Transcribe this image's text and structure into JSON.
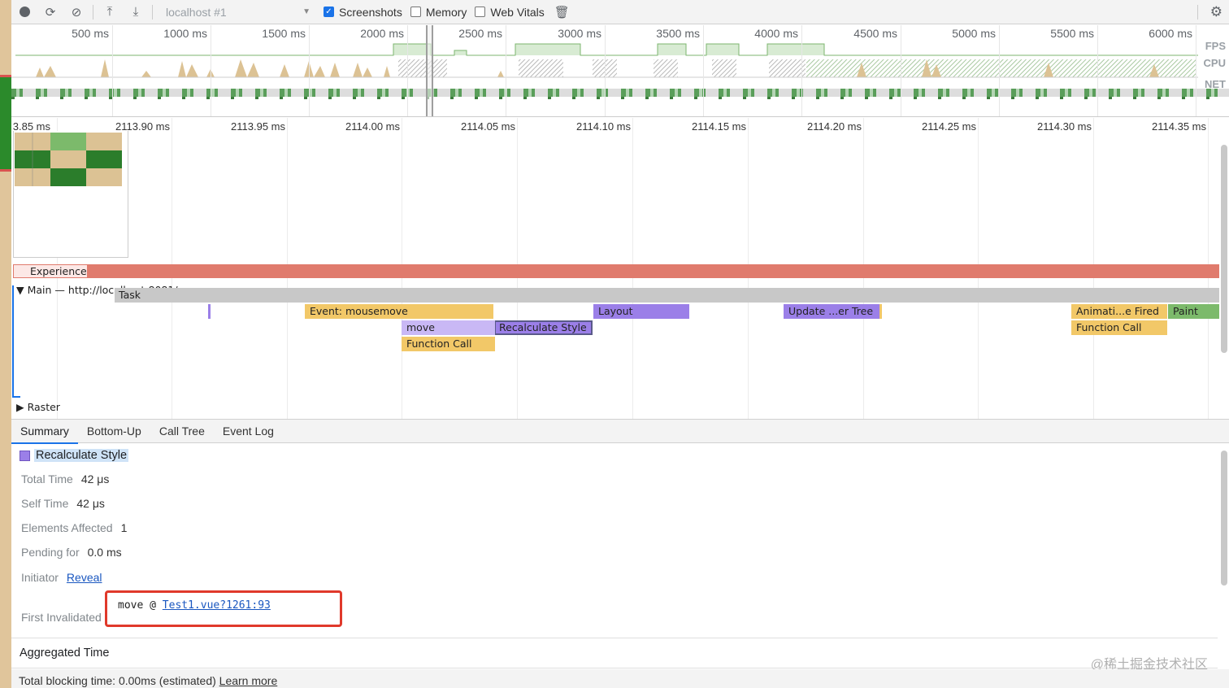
{
  "toolbar": {
    "record_icon": "record-icon",
    "reload_icon": "reload-icon",
    "clear_icon": "clear-icon",
    "upload_icon": "upload-icon",
    "download_icon": "download-icon",
    "target": "localhost #1",
    "screenshots_label": "Screenshots",
    "screenshots_checked": true,
    "memory_label": "Memory",
    "memory_checked": false,
    "web_vitals_label": "Web Vitals",
    "web_vitals_checked": false,
    "trash_icon": "trash-icon",
    "settings_icon": "gear-icon"
  },
  "overview": {
    "ticks": [
      "500 ms",
      "1000 ms",
      "1500 ms",
      "2000 ms",
      "2500 ms",
      "3000 ms",
      "3500 ms",
      "4000 ms",
      "4500 ms",
      "5000 ms",
      "5500 ms",
      "6000 ms"
    ],
    "row_labels": [
      "FPS",
      "CPU",
      "NET"
    ]
  },
  "flamechart": {
    "ticks": [
      "3.85 ms",
      "2113.90 ms",
      "2113.95 ms",
      "2114.00 ms",
      "2114.05 ms",
      "2114.10 ms",
      "2114.15 ms",
      "2114.20 ms",
      "2114.25 ms",
      "2114.30 ms",
      "2114.35 ms"
    ],
    "experience_label": "Experience",
    "main_label": "Main — http://localhost:8081/",
    "raster_label": "Raster",
    "events": [
      {
        "label": "Task",
        "color": "#c8c8c8"
      },
      {
        "label": "Event: mousemove",
        "color": "#f2c868"
      },
      {
        "label": "Recalculate Style",
        "color": "#9b7fe8"
      },
      {
        "label": "Layout",
        "color": "#9b7fe8"
      },
      {
        "label": "move",
        "color": "#c9b8f5"
      },
      {
        "label": "Function Call",
        "color": "#f2c868"
      },
      {
        "label": "Update ...er Tree",
        "color": "#9b7fe8"
      },
      {
        "label": "Animati...e Fired",
        "color": "#f2c868"
      },
      {
        "label": "Paint",
        "color": "#7cba6b"
      },
      {
        "label": "Function Call",
        "color": "#f2c868"
      }
    ]
  },
  "details": {
    "tabs": [
      "Summary",
      "Bottom-Up",
      "Call Tree",
      "Event Log"
    ],
    "active_tab": "Summary",
    "title": "Recalculate Style",
    "total_time_label": "Total Time",
    "total_time": "42 μs",
    "self_time_label": "Self Time",
    "self_time": "42 μs",
    "elements_affected_label": "Elements Affected",
    "elements_affected": "1",
    "pending_for_label": "Pending for",
    "pending_for": "0.0 ms",
    "initiator_label": "Initiator",
    "initiator_link": "Reveal",
    "first_invalidated_label": "First Invalidated",
    "first_invalidated_fn": "move @ ",
    "first_invalidated_link": "Test1.vue?1261:93",
    "aggregated_time_label": "Aggregated Time",
    "watermark": "@稀土掘金技术社区"
  },
  "footer": {
    "text": "Total blocking time: 0.00ms (estimated)",
    "link": "Learn more"
  }
}
